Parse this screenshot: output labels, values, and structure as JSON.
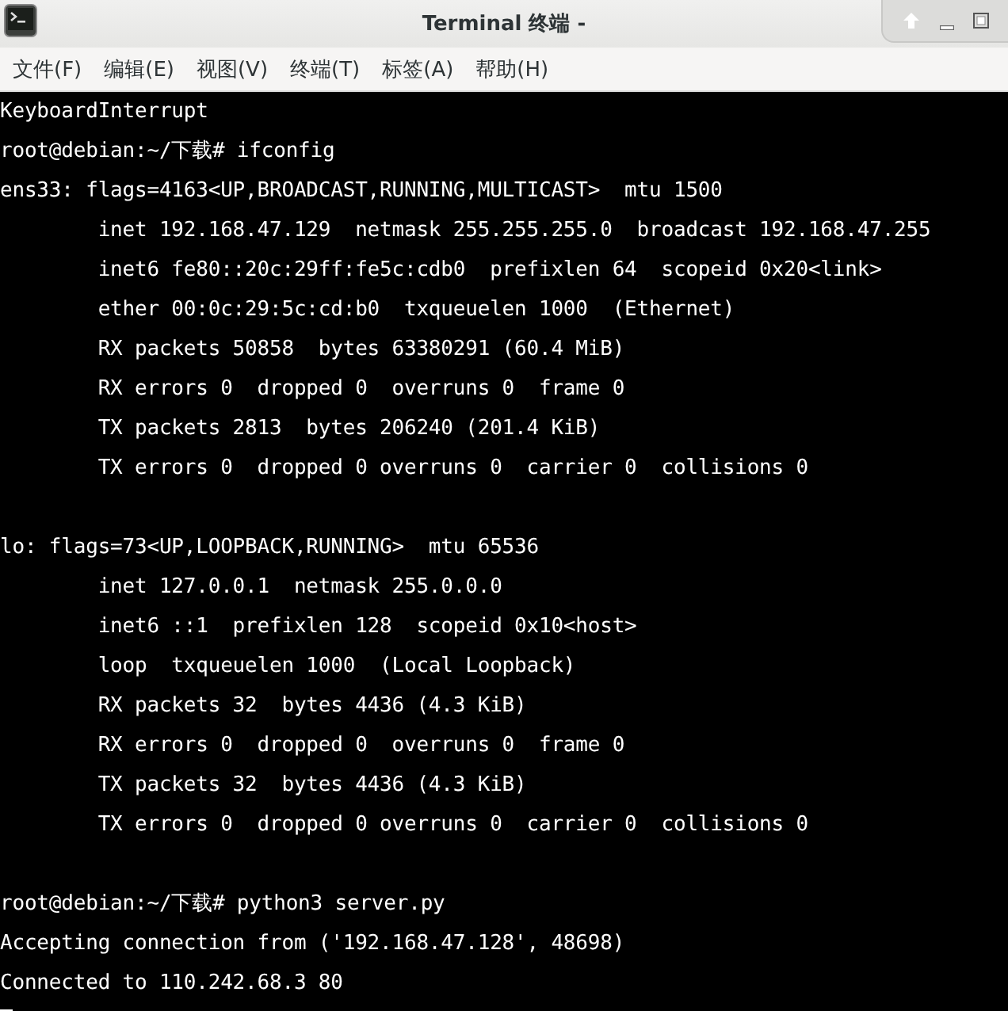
{
  "window": {
    "title": "Terminal 终端 -"
  },
  "menu": [
    "文件(F)",
    "编辑(E)",
    "视图(V)",
    "终端(T)",
    "标签(A)",
    "帮助(H)"
  ],
  "terminal": {
    "blocks": [
      [
        "KeyboardInterrupt",
        "root@debian:~/下载# ifconfig",
        "ens33: flags=4163<UP,BROADCAST,RUNNING,MULTICAST>  mtu 1500",
        "        inet 192.168.47.129  netmask 255.255.255.0  broadcast 192.168.47.255",
        "        inet6 fe80::20c:29ff:fe5c:cdb0  prefixlen 64  scopeid 0x20<link>",
        "        ether 00:0c:29:5c:cd:b0  txqueuelen 1000  (Ethernet)",
        "        RX packets 50858  bytes 63380291 (60.4 MiB)",
        "        RX errors 0  dropped 0  overruns 0  frame 0",
        "        TX packets 2813  bytes 206240 (201.4 KiB)",
        "        TX errors 0  dropped 0 overruns 0  carrier 0  collisions 0"
      ],
      [
        "lo: flags=73<UP,LOOPBACK,RUNNING>  mtu 65536",
        "        inet 127.0.0.1  netmask 255.0.0.0",
        "        inet6 ::1  prefixlen 128  scopeid 0x10<host>",
        "        loop  txqueuelen 1000  (Local Loopback)",
        "        RX packets 32  bytes 4436 (4.3 KiB)",
        "        RX errors 0  dropped 0  overruns 0  frame 0",
        "        TX packets 32  bytes 4436 (4.3 KiB)",
        "        TX errors 0  dropped 0 overruns 0  carrier 0  collisions 0"
      ],
      [
        "root@debian:~/下载# python3 server.py",
        "Accepting connection from ('192.168.47.128', 48698)",
        "Connected to 110.242.68.3 80"
      ]
    ]
  }
}
